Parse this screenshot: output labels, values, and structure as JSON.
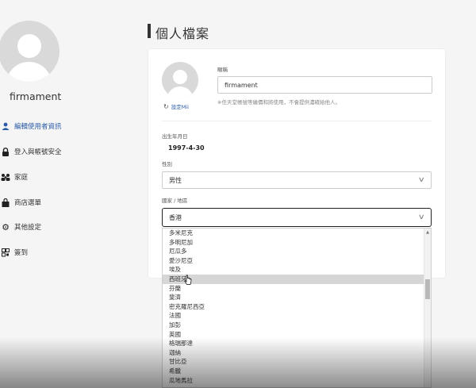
{
  "sidebar": {
    "username": "firmament",
    "items": [
      {
        "label": "編輯使用者資訊",
        "icon": "user-icon"
      },
      {
        "label": "登入與帳號安全",
        "icon": "lock-icon"
      },
      {
        "label": "家庭",
        "icon": "family-icon"
      },
      {
        "label": "商店選單",
        "icon": "shopping-bag-icon"
      },
      {
        "label": "其他設定",
        "icon": "gear-icon"
      },
      {
        "label": "簽到",
        "icon": "checkin-icon"
      }
    ]
  },
  "page": {
    "title": "個人檔案"
  },
  "profile": {
    "change_avatar_label": "設定Mii",
    "nickname_label": "暱稱",
    "nickname_value": "firmament",
    "nickname_hint": "※任天堂帳號等繪價和將使用，不會提供濃確給他人。",
    "birthday_label": "出生年月日",
    "birthday_value": "1997-4-30",
    "gender_label": "性別",
    "gender_value": "男性",
    "country_label": "國家 / 地區",
    "country_value": "香港"
  },
  "dropdown": {
    "options": [
      "多米尼克",
      "多明尼加",
      "厄瓜多",
      "愛沙尼亞",
      "埃及",
      "西班牙",
      "芬蘭",
      "斐濟",
      "密克羅尼西亞",
      "法國",
      "加彭",
      "英國",
      "格瑞那達",
      "迦納",
      "甘比亞",
      "希臘",
      "瓜地馬拉"
    ],
    "hovered_index": 5
  }
}
